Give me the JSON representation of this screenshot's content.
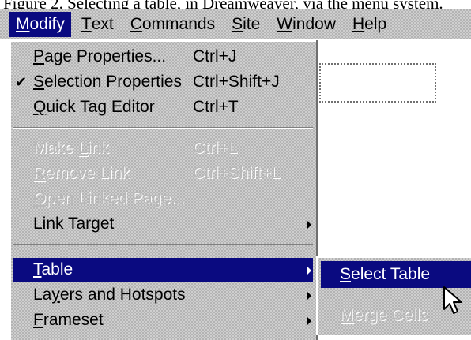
{
  "caption": "Figure 2. Selecting a table, in Dreamweaver, via the menu system.",
  "menubar": {
    "items": [
      {
        "label": "Modify",
        "u": "M",
        "rest": "odify",
        "active": true
      },
      {
        "label": "Text",
        "u": "T",
        "rest": "ext",
        "active": false
      },
      {
        "label": "Commands",
        "u": "C",
        "rest": "ommands",
        "active": false
      },
      {
        "label": "Site",
        "u": "S",
        "rest": "ite",
        "active": false
      },
      {
        "label": "Window",
        "u": "W",
        "rest": "indow",
        "active": false
      },
      {
        "label": "Help",
        "u": "H",
        "rest": "elp",
        "active": false
      }
    ]
  },
  "menu": {
    "items": [
      {
        "pre": "",
        "u": "P",
        "rest": "age Properties...",
        "shortcut": "Ctrl+J",
        "disabled": false,
        "checked": false
      },
      {
        "pre": "",
        "u": "S",
        "rest": "election Properties",
        "shortcut": "Ctrl+Shift+J",
        "disabled": false,
        "checked": true
      },
      {
        "pre": "",
        "u": "Q",
        "rest": "uick Tag Editor",
        "shortcut": "Ctrl+T",
        "disabled": false,
        "checked": false
      },
      {
        "pre": "Make ",
        "u": "L",
        "rest": "ink",
        "shortcut": "Ctrl+L",
        "disabled": true,
        "checked": false
      },
      {
        "pre": "",
        "u": "R",
        "rest": "emove Link",
        "shortcut": "Ctrl+Shift+L",
        "disabled": true,
        "checked": false
      },
      {
        "pre": "",
        "u": "O",
        "rest": "pen Linked Page...",
        "shortcut": "",
        "disabled": true,
        "checked": false
      },
      {
        "pre": "Link Tar",
        "u": "g",
        "rest": "et",
        "shortcut": "",
        "disabled": false,
        "checked": false,
        "submenu": true
      },
      {
        "pre": "",
        "u": "T",
        "rest": "able",
        "shortcut": "",
        "disabled": false,
        "checked": false,
        "submenu": true,
        "highlighted": true
      },
      {
        "pre": "La",
        "u": "y",
        "rest": "ers and Hotspots",
        "shortcut": "",
        "disabled": false,
        "checked": false,
        "submenu": true
      },
      {
        "pre": "",
        "u": "F",
        "rest": "rameset",
        "shortcut": "",
        "disabled": false,
        "checked": false,
        "submenu": true
      }
    ]
  },
  "submenu": {
    "items": [
      {
        "pre": "",
        "u": "S",
        "rest": "elect Table",
        "disabled": false,
        "highlighted": true
      },
      {
        "pre": "",
        "u": "M",
        "rest": "erge Cells",
        "disabled": true,
        "highlighted": false
      }
    ]
  },
  "icons": {
    "check": "check-icon",
    "submenu_arrow": "chevron-right-icon",
    "cursor": "mouse-pointer-icon"
  },
  "colors": {
    "highlight": "#0a0a80",
    "menu_face": "#c0c0c0",
    "disabled_text": "#b8b8b8"
  }
}
